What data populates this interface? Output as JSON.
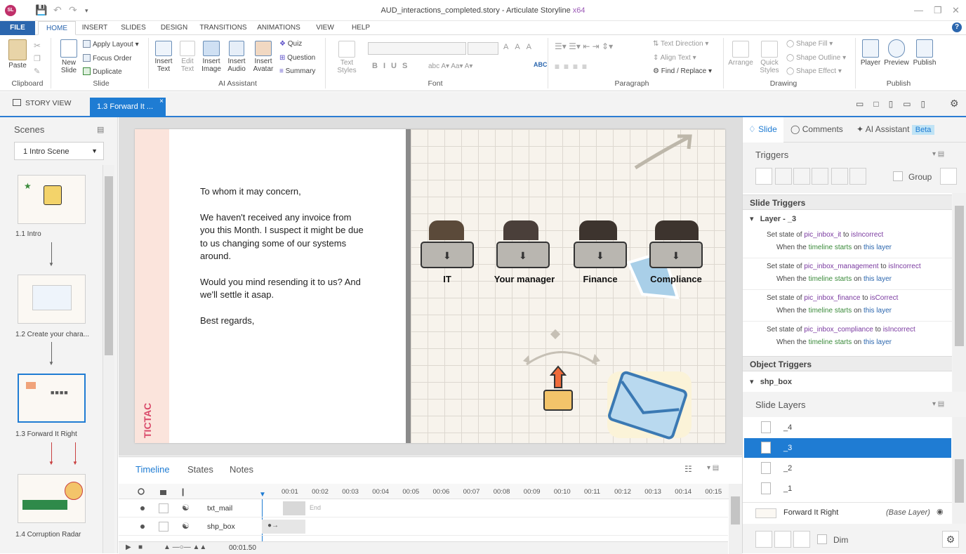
{
  "window": {
    "user_initials": "SL",
    "title": "AUD_interactions_completed.story - Articulate Storyline",
    "arch": "x64"
  },
  "menu": [
    "FILE",
    "HOME",
    "INSERT",
    "SLIDES",
    "DESIGN",
    "TRANSITIONS",
    "ANIMATIONS",
    "VIEW",
    "HELP"
  ],
  "ribbon": {
    "clipboard": {
      "paste": "Paste",
      "group": "Clipboard"
    },
    "slide": {
      "new_slide": "New Slide",
      "apply_layout": "Apply Layout",
      "focus_order": "Focus Order",
      "duplicate": "Duplicate",
      "group": "Slide"
    },
    "ai": {
      "insert_text": "Insert Text",
      "edit_text": "Edit Text",
      "insert_image": "Insert Image",
      "insert_audio": "Insert Audio",
      "insert_avatar": "Insert Avatar",
      "quiz": "Quiz",
      "question": "Question",
      "summary": "Summary",
      "group": "AI Assistant"
    },
    "font": {
      "text_styles": "Text Styles",
      "group": "Font"
    },
    "paragraph": {
      "text_direction": "Text Direction",
      "align_text": "Align Text",
      "find_replace": "Find / Replace",
      "group": "Paragraph"
    },
    "drawing": {
      "arrange": "Arrange",
      "quick_styles": "Quick Styles",
      "shape_fill": "Shape Fill",
      "shape_outline": "Shape Outline",
      "shape_effect": "Shape Effect",
      "group": "Drawing"
    },
    "publish": {
      "player": "Player",
      "preview": "Preview",
      "publish": "Publish",
      "group": "Publish"
    }
  },
  "views": {
    "story_view": "STORY VIEW",
    "slide_tab": "1.3 Forward It ..."
  },
  "scenes": {
    "header": "Scenes",
    "selected": "1 Intro Scene",
    "items": [
      {
        "label": "1.1 Intro"
      },
      {
        "label": "1.2 Create your chara..."
      },
      {
        "label": "1.3 Forward It Right"
      },
      {
        "label": "1.4 Corruption Radar"
      }
    ]
  },
  "slide": {
    "letter": [
      "To whom it may concern,",
      "We haven't received any invoice from",
      "you this Month. I suspect it might be due",
      "to us changing some of our systems",
      "around.",
      "Would you mind resending it to us? And",
      "we'll settle it asap.",
      "Best regards,"
    ],
    "brand": "TICTAC",
    "inboxes": [
      "IT",
      "Your manager",
      "Finance",
      "Compliance"
    ]
  },
  "timeline": {
    "tabs": [
      "Timeline",
      "States",
      "Notes"
    ],
    "ticks": [
      "00:01",
      "00:02",
      "00:03",
      "00:04",
      "00:05",
      "00:06",
      "00:07",
      "00:08",
      "00:09",
      "00:10",
      "00:11",
      "00:12",
      "00:13",
      "00:14",
      "00:15"
    ],
    "rows": [
      {
        "name": "txt_mail"
      },
      {
        "name": "shp_box"
      }
    ],
    "end_label": "End",
    "time": "00:01.50"
  },
  "right_panel": {
    "tabs": [
      "Slide",
      "Comments",
      "AI Assistant"
    ],
    "beta": "Beta",
    "triggers_header": "Triggers",
    "group_label": "Group",
    "slide_triggers": "Slide Triggers",
    "layer_label": "Layer - _3",
    "triggers": [
      {
        "obj": "pic_inbox_it",
        "state": "isIncorrect"
      },
      {
        "obj": "pic_inbox_management",
        "state": "isIncorrect"
      },
      {
        "obj": "pic_inbox_finance",
        "state": "isCorrect"
      },
      {
        "obj": "pic_inbox_compliance",
        "state": "isIncorrect"
      }
    ],
    "trigger_words": {
      "set_state": "Set state of",
      "to": "to",
      "when": "When the",
      "timeline_starts": "timeline starts",
      "on": "on",
      "this_layer": "this layer"
    },
    "object_triggers": "Object Triggers",
    "object_name": "shp_box",
    "slide_layers": "Slide Layers",
    "layers": [
      "_4",
      "_3",
      "_2",
      "_1"
    ],
    "base_layer": "Forward It Right",
    "base_layer_tag": "(Base Layer)",
    "dim": "Dim"
  },
  "colors": {
    "accent": "#1f7cd3",
    "file_tab": "#2b66ae",
    "variable": "#7a3aa0",
    "event": "#3a8a3a"
  }
}
